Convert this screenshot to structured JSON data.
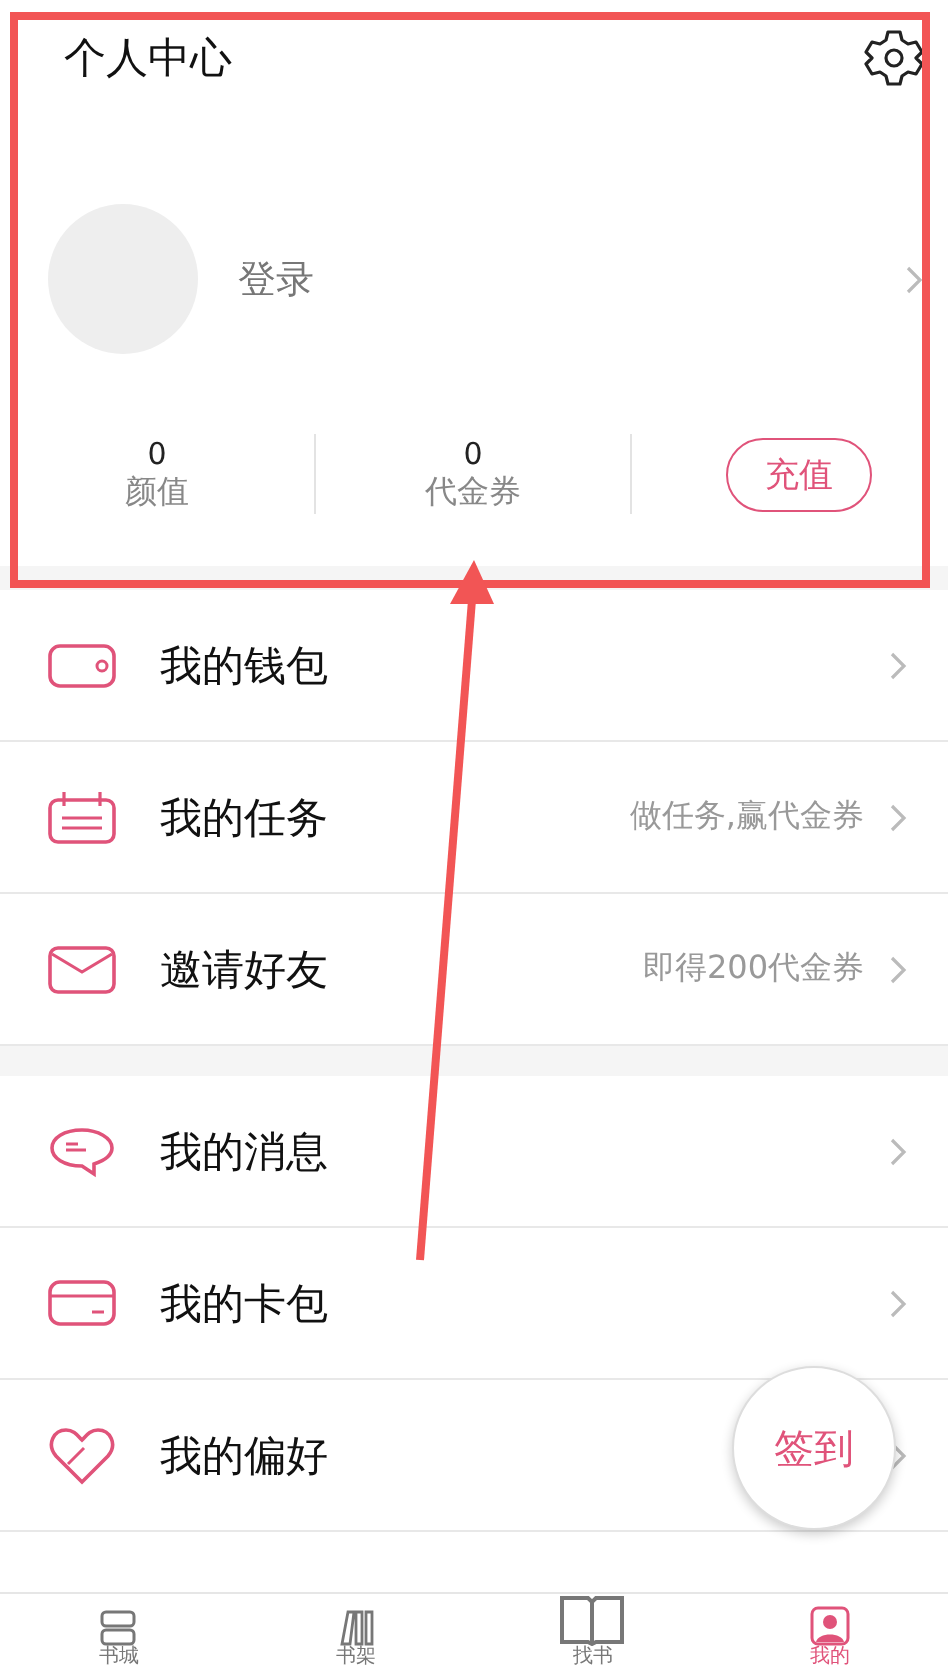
{
  "header": {
    "title": "个人中心",
    "login": "登录",
    "stats": [
      {
        "value": "0",
        "label": "颜值"
      },
      {
        "value": "0",
        "label": "代金券"
      }
    ],
    "recharge": "充值"
  },
  "menu_groups": [
    [
      {
        "label": "我的钱包"
      },
      {
        "label": "我的任务",
        "hint": "做任务,赢代金券"
      },
      {
        "label": "邀请好友",
        "hint": "即得200代金券"
      }
    ],
    [
      {
        "label": "我的消息"
      },
      {
        "label": "我的卡包"
      },
      {
        "label": "我的偏好"
      }
    ]
  ],
  "checkin": "签到",
  "tabs": [
    {
      "label": "书城",
      "selected": false
    },
    {
      "label": "书架",
      "selected": false
    },
    {
      "label": "找书",
      "selected": false
    },
    {
      "label": "我的",
      "selected": true
    }
  ]
}
